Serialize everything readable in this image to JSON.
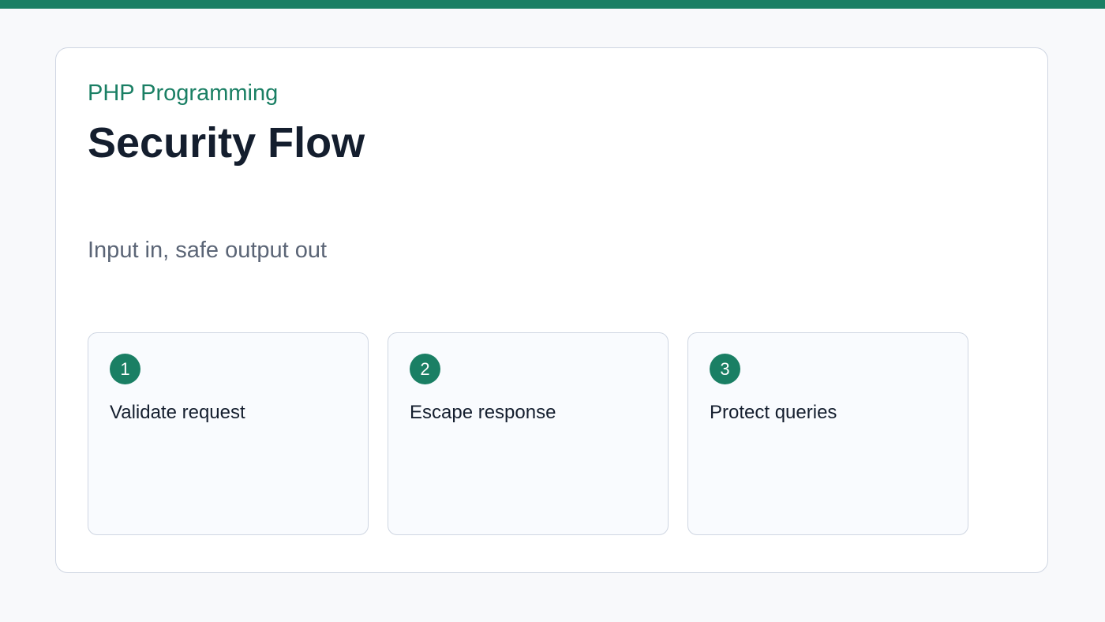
{
  "header": {
    "eyebrow": "PHP Programming",
    "title": "Security Flow",
    "subtitle": "Input in, safe output out"
  },
  "steps": [
    {
      "number": "1",
      "label": "Validate request"
    },
    {
      "number": "2",
      "label": "Escape response"
    },
    {
      "number": "3",
      "label": "Protect queries"
    }
  ],
  "colors": {
    "accent": "#1a7f64",
    "title": "#141e2e",
    "subtitle": "#5b6576",
    "background": "#f8f9fb",
    "border": "#cfd6e2"
  }
}
